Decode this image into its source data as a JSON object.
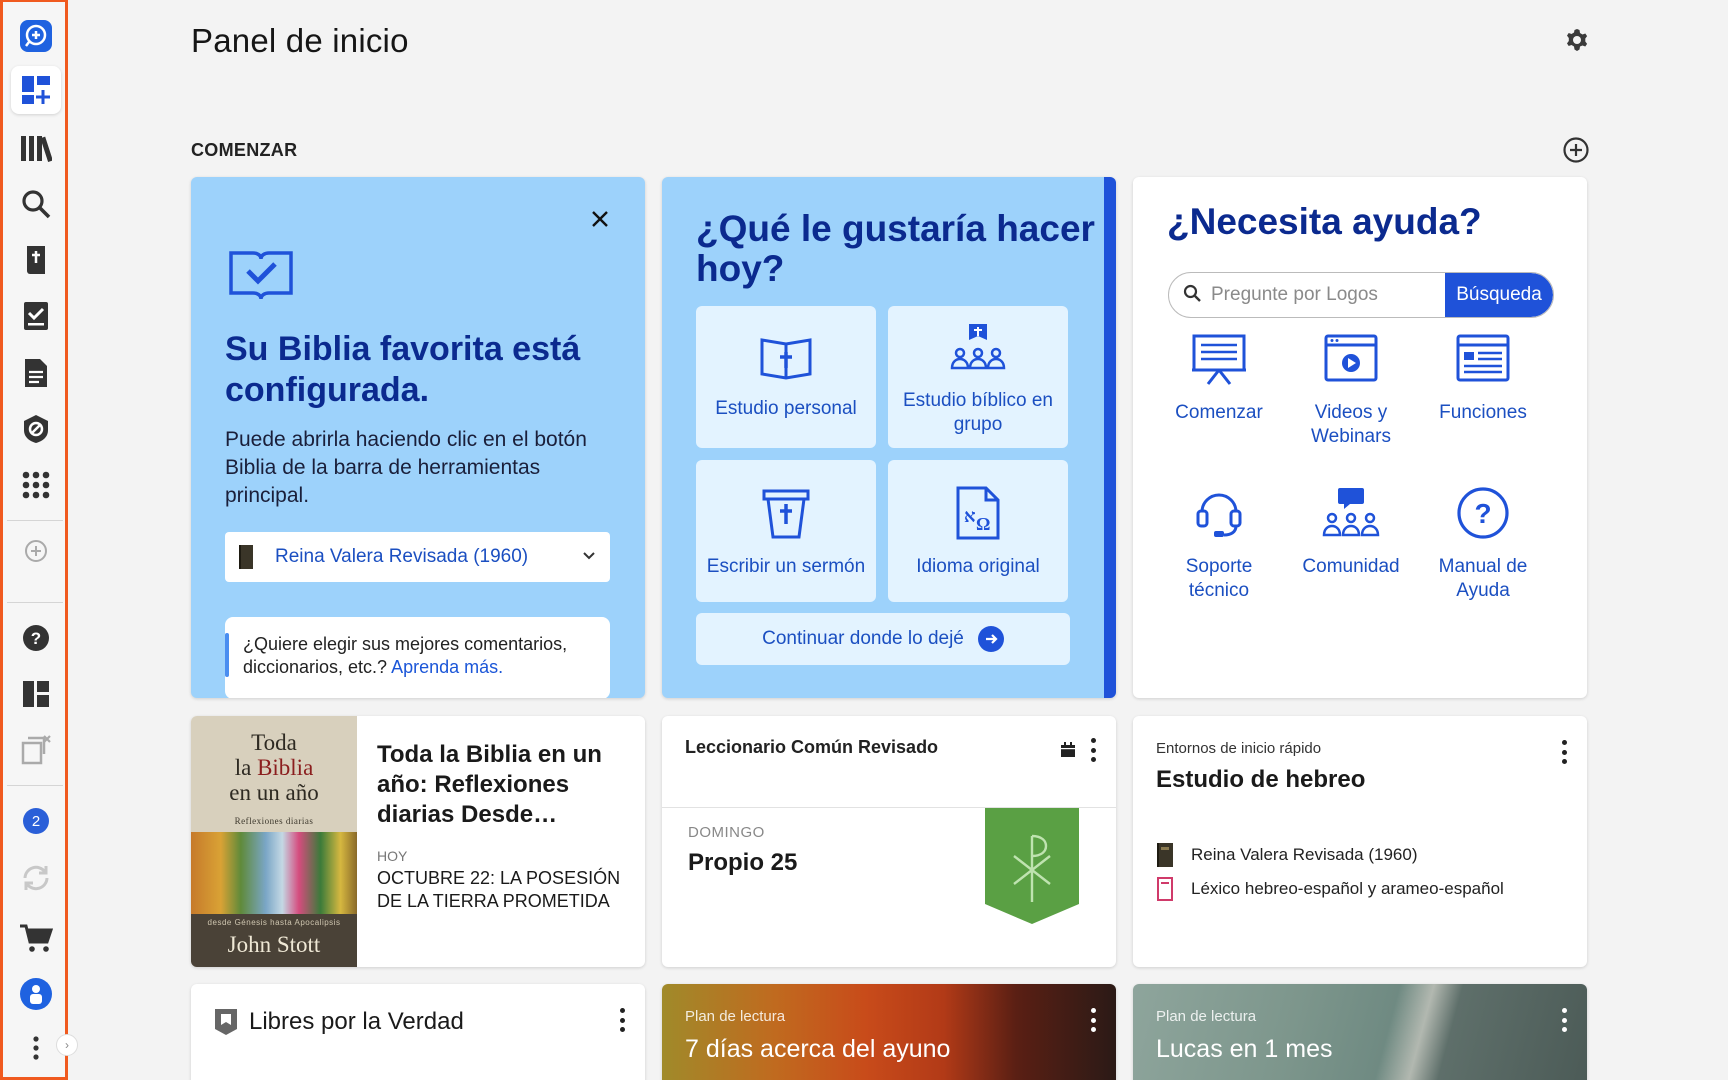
{
  "page": {
    "title": "Panel de inicio"
  },
  "sidebar": {
    "badge_count": "2",
    "items": [
      {
        "name": "logos-search-icon"
      },
      {
        "name": "dashboard-icon"
      },
      {
        "name": "library-icon"
      },
      {
        "name": "search-icon"
      },
      {
        "name": "bible-icon"
      },
      {
        "name": "checklist-icon"
      },
      {
        "name": "document-icon"
      },
      {
        "name": "shield-icon"
      },
      {
        "name": "apps-grid-icon"
      },
      {
        "name": "add-icon"
      },
      {
        "name": "help-icon"
      },
      {
        "name": "layout-icon"
      },
      {
        "name": "close-panels-icon"
      },
      {
        "name": "sync-icon"
      },
      {
        "name": "cart-icon"
      },
      {
        "name": "account-icon"
      },
      {
        "name": "more-icon"
      }
    ]
  },
  "section": {
    "label": "COMENZAR"
  },
  "bible_card": {
    "title": "Su Biblia favorita está configurada.",
    "description": "Puede abrirla haciendo clic en el botón Biblia de la barra de herramientas principal.",
    "selected_bible": "Reina Valera Revisada (1960)",
    "tip_text": "¿Quiere elegir sus mejores comentarios, diccionarios, etc.? ",
    "tip_link": "Aprenda más."
  },
  "today_card": {
    "title": "¿Qué le gustaría hacer hoy?",
    "tiles": [
      {
        "label": "Estudio personal"
      },
      {
        "label": "Estudio bíblico en grupo"
      },
      {
        "label": "Escribir un sermón"
      },
      {
        "label": "Idioma original"
      }
    ],
    "continue_label": "Continuar donde lo dejé"
  },
  "help_card": {
    "title": "¿Necesita ayuda?",
    "search_placeholder": "Pregunte por Logos",
    "search_button": "Búsqueda",
    "items": [
      {
        "label": "Comenzar"
      },
      {
        "label": "Videos y Webinars"
      },
      {
        "label": "Funciones"
      },
      {
        "label": "Soporte técnico"
      },
      {
        "label": "Comunidad"
      },
      {
        "label": "Manual de Ayuda"
      }
    ]
  },
  "reading_card": {
    "cover_line1": "Toda",
    "cover_line2a": "la ",
    "cover_line2b": "Biblia",
    "cover_line3": "en un año",
    "cover_sub": "Reflexiones diarias",
    "cover_sub2": "desde Génesis hasta Apocalipsis",
    "cover_author": "John Stott",
    "title": "Toda la Biblia en un año: Reflexiones diarias Desde…",
    "label": "HOY",
    "detail": "OCTUBRE 22: LA POSESIÓN DE LA TIERRA PROMETIDA"
  },
  "lectionary_card": {
    "title": "Leccionario Común Revisado",
    "day_label": "DOMINGO",
    "day_value": "Propio 25",
    "banner_color": "#5aa044"
  },
  "workspace_card": {
    "label": "Entornos de inicio rápido",
    "title": "Estudio de hebreo",
    "resources": [
      {
        "label": "Reina Valera Revisada (1960)"
      },
      {
        "label": "Léxico hebreo-español y arameo-español"
      }
    ]
  },
  "libres_card": {
    "title": "Libres por la Verdad"
  },
  "plan_cards": [
    {
      "label": "Plan de lectura",
      "title": "7 días acerca del ayuno"
    },
    {
      "label": "Plan de lectura",
      "title": "Lucas en 1 mes"
    }
  ],
  "colors": {
    "accent": "#1f52d9",
    "title_blue": "#0b2a8f",
    "card_blue": "#9dd2fb",
    "sidebar_outline": "#f05a1f"
  }
}
